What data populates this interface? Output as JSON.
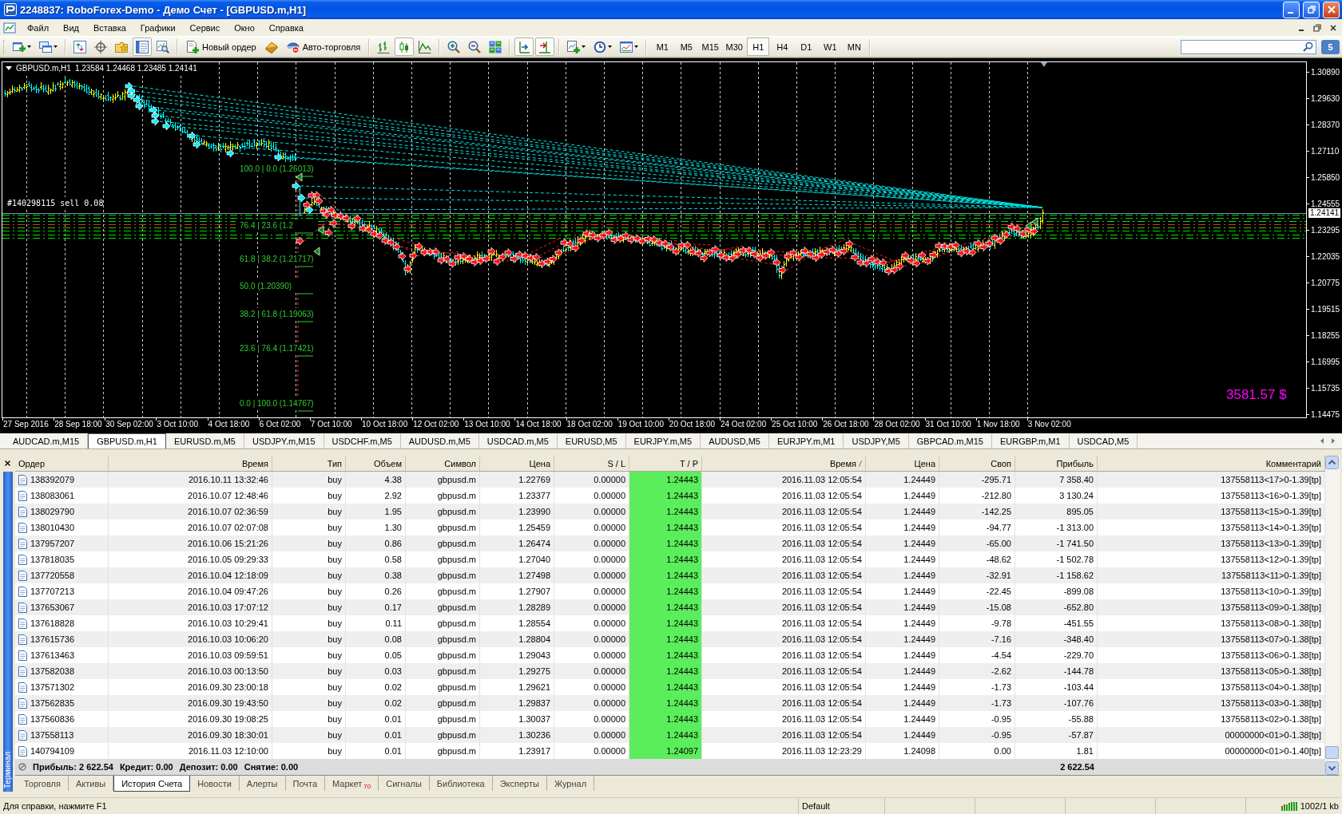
{
  "window": {
    "title": "2248837: RoboForex-Demo - Демо Счет - [GBPUSD.m,H1]"
  },
  "menu": [
    "Файл",
    "Вид",
    "Вставка",
    "Графики",
    "Сервис",
    "Окно",
    "Справка"
  ],
  "toolbar": {
    "market_watch": false,
    "data_window": false,
    "navigator": false,
    "terminal": true,
    "tester": false,
    "new_order": "Новый ордер",
    "auto_trading": {
      "label": "Авто-торговля",
      "on": false
    },
    "bar_chart": false,
    "candlesticks": true,
    "line_chart": false,
    "chart_shift": true,
    "auto_scroll": true,
    "timeframes": [
      {
        "label": "M1",
        "selected": false
      },
      {
        "label": "M5",
        "selected": false
      },
      {
        "label": "M15",
        "selected": false
      },
      {
        "label": "M30",
        "selected": false
      },
      {
        "label": "H1",
        "selected": true
      },
      {
        "label": "H4",
        "selected": false
      },
      {
        "label": "D1",
        "selected": false
      },
      {
        "label": "W1",
        "selected": false
      },
      {
        "label": "MN",
        "selected": false
      }
    ],
    "notifications": "5"
  },
  "chart": {
    "symbol": "GBPUSD.m,H1",
    "ohlc": "1.23584 1.24468 1.23485 1.24141",
    "order_labels": [
      "#140298115 sell 0.08"
    ],
    "fib_levels": [
      "100.0 | 0.0 (1.26013)",
      "76.4 | 23.6 (1.2",
      "61.8 | 38.2 (1.21717)",
      "50.0 (1.20390)",
      "38.2 | 61.8 (1.19063)",
      "23.6 | 76.4 (1.17421)",
      "0.0 | 100.0 (1.14767)"
    ],
    "equity": "3581.57 $",
    "price_scale": [
      "1.30890",
      "1.29630",
      "1.28370",
      "1.27110",
      "1.25850",
      "1.24555",
      "1.23295",
      "1.22035",
      "1.20775",
      "1.19515",
      "1.18255",
      "1.16995",
      "1.15735",
      "1.14475"
    ],
    "current_price": "1.24141",
    "time_scale": [
      "27 Sep 2016",
      "28 Sep 18:00",
      "30 Sep 02:00",
      "3 Oct 10:00",
      "4 Oct 18:00",
      "6 Oct 02:00",
      "7 Oct 10:00",
      "10 Oct 18:00",
      "12 Oct 02:00",
      "13 Oct 10:00",
      "14 Oct 18:00",
      "18 Oct 02:00",
      "19 Oct 10:00",
      "20 Oct 18:00",
      "24 Oct 02:00",
      "25 Oct 10:00",
      "26 Oct 18:00",
      "28 Oct 02:00",
      "31 Oct 10:00",
      "1 Nov 18:00",
      "3 Nov 02:00"
    ]
  },
  "chart_tabs": [
    {
      "label": "AUDCAD.m,M15",
      "selected": false
    },
    {
      "label": "GBPUSD.m,H1",
      "selected": true
    },
    {
      "label": "EURUSD.m,M5",
      "selected": false
    },
    {
      "label": "USDJPY.m,M15",
      "selected": false
    },
    {
      "label": "USDCHF.m,M5",
      "selected": false
    },
    {
      "label": "AUDUSD.m,M5",
      "selected": false
    },
    {
      "label": "USDCAD.m,M5",
      "selected": false
    },
    {
      "label": "EURUSD,M5",
      "selected": false
    },
    {
      "label": "EURJPY.m,M5",
      "selected": false
    },
    {
      "label": "AUDUSD,M5",
      "selected": false
    },
    {
      "label": "EURJPY.m,M1",
      "selected": false
    },
    {
      "label": "USDJPY,M5",
      "selected": false
    },
    {
      "label": "GBPCAD.m,M15",
      "selected": false
    },
    {
      "label": "EURGBP.m,M1",
      "selected": false
    },
    {
      "label": "USDCAD,M5",
      "selected": false
    }
  ],
  "terminal": {
    "title": "Терминал",
    "columns": [
      {
        "label": "Ордер",
        "sorted": false
      },
      {
        "label": "Время",
        "sorted": false
      },
      {
        "label": "Тип",
        "sorted": false
      },
      {
        "label": "Объем",
        "sorted": false
      },
      {
        "label": "Символ",
        "sorted": false
      },
      {
        "label": "Цена",
        "sorted": false
      },
      {
        "label": "S / L",
        "sorted": false
      },
      {
        "label": "T / P",
        "sorted": false
      },
      {
        "label": "Время",
        "sorted": true
      },
      {
        "label": "Цена",
        "sorted": false
      },
      {
        "label": "Своп",
        "sorted": false
      },
      {
        "label": "Прибыль",
        "sorted": false
      },
      {
        "label": "Комментарий",
        "sorted": false
      }
    ],
    "rows": [
      {
        "cells": [
          "138392079",
          "2016.10.11 13:32:46",
          "buy",
          "4.38",
          "gbpusd.m",
          "1.22769",
          "0.00000",
          "1.24443",
          "2016.11.03 12:05:54",
          "1.24449",
          "-295.71",
          "7 358.40",
          "137558113<17>0-1.39[tp]"
        ],
        "tp_hit": true
      },
      {
        "cells": [
          "138083061",
          "2016.10.07 12:48:46",
          "buy",
          "2.92",
          "gbpusd.m",
          "1.23377",
          "0.00000",
          "1.24443",
          "2016.11.03 12:05:54",
          "1.24449",
          "-212.80",
          "3 130.24",
          "137558113<16>0-1.39[tp]"
        ],
        "tp_hit": true
      },
      {
        "cells": [
          "138029790",
          "2016.10.07 02:36:59",
          "buy",
          "1.95",
          "gbpusd.m",
          "1.23990",
          "0.00000",
          "1.24443",
          "2016.11.03 12:05:54",
          "1.24449",
          "-142.25",
          "895.05",
          "137558113<15>0-1.39[tp]"
        ],
        "tp_hit": true
      },
      {
        "cells": [
          "138010430",
          "2016.10.07 02:07:08",
          "buy",
          "1.30",
          "gbpusd.m",
          "1.25459",
          "0.00000",
          "1.24443",
          "2016.11.03 12:05:54",
          "1.24449",
          "-94.77",
          "-1 313.00",
          "137558113<14>0-1.39[tp]"
        ],
        "tp_hit": true
      },
      {
        "cells": [
          "137957207",
          "2016.10.06 15:21:26",
          "buy",
          "0.86",
          "gbpusd.m",
          "1.26474",
          "0.00000",
          "1.24443",
          "2016.11.03 12:05:54",
          "1.24449",
          "-65.00",
          "-1 741.50",
          "137558113<13>0-1.39[tp]"
        ],
        "tp_hit": true
      },
      {
        "cells": [
          "137818035",
          "2016.10.05 09:29:33",
          "buy",
          "0.58",
          "gbpusd.m",
          "1.27040",
          "0.00000",
          "1.24443",
          "2016.11.03 12:05:54",
          "1.24449",
          "-48.62",
          "-1 502.78",
          "137558113<12>0-1.39[tp]"
        ],
        "tp_hit": true
      },
      {
        "cells": [
          "137720558",
          "2016.10.04 12:18:09",
          "buy",
          "0.38",
          "gbpusd.m",
          "1.27498",
          "0.00000",
          "1.24443",
          "2016.11.03 12:05:54",
          "1.24449",
          "-32.91",
          "-1 158.62",
          "137558113<11>0-1.39[tp]"
        ],
        "tp_hit": true
      },
      {
        "cells": [
          "137707213",
          "2016.10.04 09:47:26",
          "buy",
          "0.26",
          "gbpusd.m",
          "1.27907",
          "0.00000",
          "1.24443",
          "2016.11.03 12:05:54",
          "1.24449",
          "-22.45",
          "-899.08",
          "137558113<10>0-1.39[tp]"
        ],
        "tp_hit": true
      },
      {
        "cells": [
          "137653067",
          "2016.10.03 17:07:12",
          "buy",
          "0.17",
          "gbpusd.m",
          "1.28289",
          "0.00000",
          "1.24443",
          "2016.11.03 12:05:54",
          "1.24449",
          "-15.08",
          "-652.80",
          "137558113<09>0-1.38[tp]"
        ],
        "tp_hit": true
      },
      {
        "cells": [
          "137618828",
          "2016.10.03 10:29:41",
          "buy",
          "0.11",
          "gbpusd.m",
          "1.28554",
          "0.00000",
          "1.24443",
          "2016.11.03 12:05:54",
          "1.24449",
          "-9.78",
          "-451.55",
          "137558113<08>0-1.38[tp]"
        ],
        "tp_hit": true
      },
      {
        "cells": [
          "137615736",
          "2016.10.03 10:06:20",
          "buy",
          "0.08",
          "gbpusd.m",
          "1.28804",
          "0.00000",
          "1.24443",
          "2016.11.03 12:05:54",
          "1.24449",
          "-7.16",
          "-348.40",
          "137558113<07>0-1.38[tp]"
        ],
        "tp_hit": true
      },
      {
        "cells": [
          "137613463",
          "2016.10.03 09:59:51",
          "buy",
          "0.05",
          "gbpusd.m",
          "1.29043",
          "0.00000",
          "1.24443",
          "2016.11.03 12:05:54",
          "1.24449",
          "-4.54",
          "-229.70",
          "137558113<06>0-1.38[tp]"
        ],
        "tp_hit": true
      },
      {
        "cells": [
          "137582038",
          "2016.10.03 00:13:50",
          "buy",
          "0.03",
          "gbpusd.m",
          "1.29275",
          "0.00000",
          "1.24443",
          "2016.11.03 12:05:54",
          "1.24449",
          "-2.62",
          "-144.78",
          "137558113<05>0-1.38[tp]"
        ],
        "tp_hit": true
      },
      {
        "cells": [
          "137571302",
          "2016.09.30 23:00:18",
          "buy",
          "0.02",
          "gbpusd.m",
          "1.29621",
          "0.00000",
          "1.24443",
          "2016.11.03 12:05:54",
          "1.24449",
          "-1.73",
          "-103.44",
          "137558113<04>0-1.38[tp]"
        ],
        "tp_hit": true
      },
      {
        "cells": [
          "137562835",
          "2016.09.30 19:43:50",
          "buy",
          "0.02",
          "gbpusd.m",
          "1.29837",
          "0.00000",
          "1.24443",
          "2016.11.03 12:05:54",
          "1.24449",
          "-1.73",
          "-107.76",
          "137558113<03>0-1.38[tp]"
        ],
        "tp_hit": true
      },
      {
        "cells": [
          "137560836",
          "2016.09.30 19:08:25",
          "buy",
          "0.01",
          "gbpusd.m",
          "1.30037",
          "0.00000",
          "1.24443",
          "2016.11.03 12:05:54",
          "1.24449",
          "-0.95",
          "-55.88",
          "137558113<02>0-1.38[tp]"
        ],
        "tp_hit": true
      },
      {
        "cells": [
          "137558113",
          "2016.09.30 18:30:01",
          "buy",
          "0.01",
          "gbpusd.m",
          "1.30236",
          "0.00000",
          "1.24443",
          "2016.11.03 12:05:54",
          "1.24449",
          "-0.95",
          "-57.87",
          "00000000<01>0-1.38[tp]"
        ],
        "tp_hit": true
      },
      {
        "cells": [
          "140794109",
          "2016.11.03 12:10:00",
          "buy",
          "0.01",
          "gbpusd.m",
          "1.23917",
          "0.00000",
          "1.24097",
          "2016.11.03 12:23:29",
          "1.24098",
          "0.00",
          "1.81",
          "00000000<01>0-1.40[tp]"
        ],
        "tp_hit": true
      }
    ],
    "summary": {
      "items": [
        "Прибыль: 2 622.54",
        "Кредит: 0.00",
        "Депозит: 0.00",
        "Снятие: 0.00"
      ],
      "profit": "2 622.54"
    },
    "tabs": [
      {
        "label": "Торговля",
        "selected": false
      },
      {
        "label": "Активы",
        "selected": false
      },
      {
        "label": "История Счета",
        "selected": true
      },
      {
        "label": "Новости",
        "selected": false
      },
      {
        "label": "Алерты",
        "selected": false
      },
      {
        "label": "Почта",
        "selected": false
      },
      {
        "label": "Маркет",
        "selected": false,
        "badge": "70"
      },
      {
        "label": "Сигналы",
        "selected": false
      },
      {
        "label": "Библиотека",
        "selected": false
      },
      {
        "label": "Эксперты",
        "selected": false
      },
      {
        "label": "Журнал",
        "selected": false
      }
    ]
  },
  "status_bar": {
    "help": "Для справки, нажмите F1",
    "profile": "Default",
    "traffic": "1002/1 kb"
  }
}
